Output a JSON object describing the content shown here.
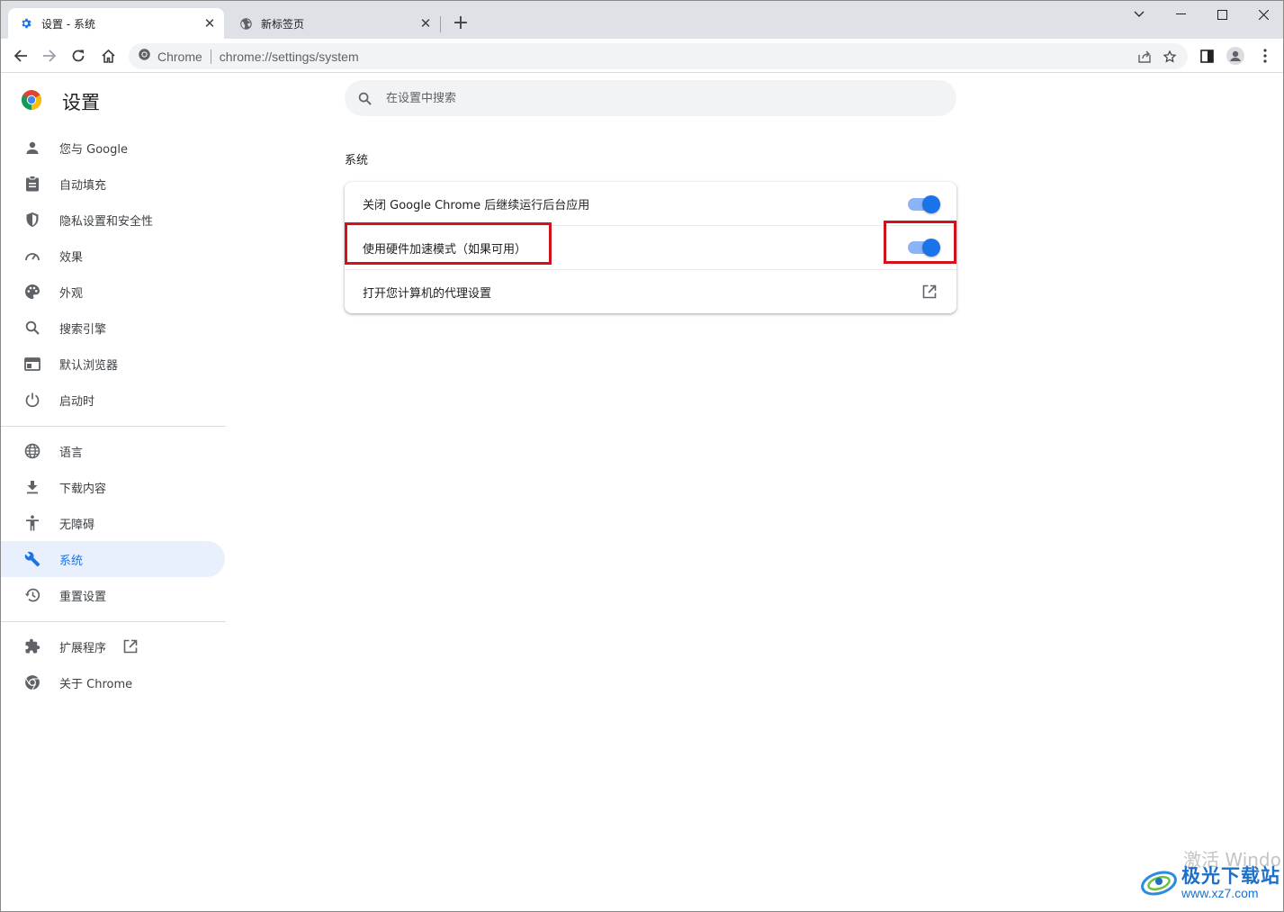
{
  "tabs": [
    {
      "title": "设置 - 系统",
      "icon": "gear-icon",
      "active": true
    },
    {
      "title": "新标签页",
      "icon": "globe-icon",
      "active": false
    }
  ],
  "address_bar": {
    "site_label": "Chrome",
    "url": "chrome://settings/system"
  },
  "sidebar": {
    "title": "设置",
    "groups": [
      [
        {
          "label": "您与 Google",
          "icon": "person-icon"
        },
        {
          "label": "自动填充",
          "icon": "clipboard-icon"
        },
        {
          "label": "隐私设置和安全性",
          "icon": "shield-icon"
        },
        {
          "label": "效果",
          "icon": "speedometer-icon"
        },
        {
          "label": "外观",
          "icon": "palette-icon"
        },
        {
          "label": "搜索引擎",
          "icon": "search-icon"
        },
        {
          "label": "默认浏览器",
          "icon": "browser-icon"
        },
        {
          "label": "启动时",
          "icon": "power-icon"
        }
      ],
      [
        {
          "label": "语言",
          "icon": "globe-icon"
        },
        {
          "label": "下载内容",
          "icon": "download-icon"
        },
        {
          "label": "无障碍",
          "icon": "accessibility-icon"
        },
        {
          "label": "系统",
          "icon": "wrench-icon",
          "selected": true
        },
        {
          "label": "重置设置",
          "icon": "history-icon"
        }
      ],
      [
        {
          "label": "扩展程序",
          "icon": "puzzle-icon",
          "external": true
        },
        {
          "label": "关于 Chrome",
          "icon": "chrome-icon"
        }
      ]
    ]
  },
  "search": {
    "placeholder": "在设置中搜索"
  },
  "section": {
    "title": "系统",
    "rows": [
      {
        "label": "关闭 Google Chrome 后继续运行后台应用",
        "control": "toggle",
        "on": true
      },
      {
        "label": "使用硬件加速模式（如果可用）",
        "control": "toggle",
        "on": true
      },
      {
        "label": "打开您计算机的代理设置",
        "control": "external-link"
      }
    ]
  },
  "colors": {
    "accent": "#1a73e8",
    "toggle_track": "#8ab4f8",
    "selected_bg": "#e8f0fe",
    "highlight_box": "#d0121b"
  },
  "watermark": {
    "activate_text": "激活 Windo",
    "site_name": "极光下载站",
    "site_url": "www.xz7.com"
  }
}
